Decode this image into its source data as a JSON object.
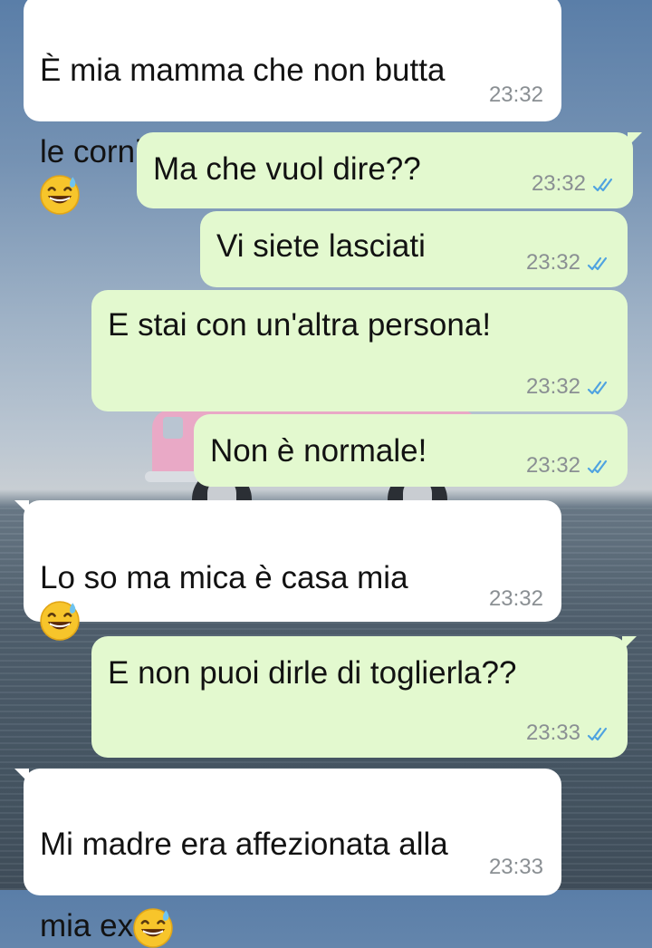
{
  "messages": [
    {
      "direction": "incoming",
      "text": "È mia mamma che non butta le cornici vecchie",
      "emoji": "grinning-sweat-emoji",
      "time": "23:32"
    },
    {
      "direction": "outgoing",
      "text": "Ma che vuol dire??",
      "time": "23:32",
      "status": "read-double-check"
    },
    {
      "direction": "outgoing",
      "text": "Vi siete lasciati",
      "time": "23:32",
      "status": "read-double-check"
    },
    {
      "direction": "outgoing",
      "text": "E stai con un'altra persona!",
      "time": "23:32",
      "status": "read-double-check"
    },
    {
      "direction": "outgoing",
      "text": "Non è normale!",
      "time": "23:32",
      "status": "read-double-check"
    },
    {
      "direction": "incoming",
      "text": "Lo so ma mica è casa mia",
      "emoji": "grinning-sweat-emoji",
      "time": "23:32"
    },
    {
      "direction": "outgoing",
      "text": "E non puoi dirle di toglierla??",
      "time": "23:33",
      "status": "read-double-check"
    },
    {
      "direction": "incoming",
      "text": "Mi madre era affezionata alla mia ex",
      "emoji": "grinning-sweat-emoji",
      "time": "23:33"
    }
  ],
  "text_lines": {
    "m1_l1": "È mia mamma che non butta",
    "m1_l2": "le cornici vecchie",
    "m8_l1": "Mi madre era affezionata alla",
    "m8_l2": "mia ex"
  },
  "colors": {
    "incoming_bubble": "#ffffff",
    "outgoing_bubble": "#e3f9cf",
    "read_ticks": "#4fa3e0",
    "timestamp": "#8a8f93"
  }
}
